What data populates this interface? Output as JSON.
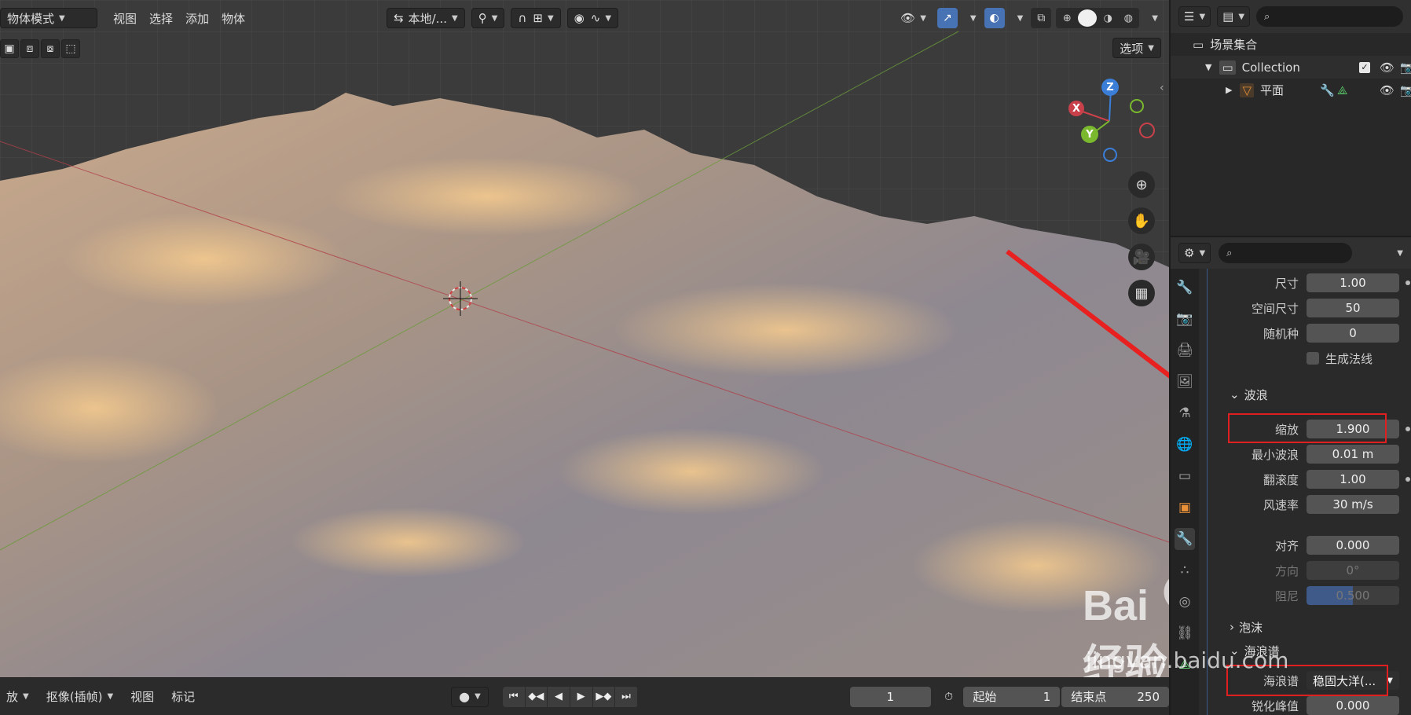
{
  "viewport": {
    "mode_label": "物体模式",
    "menus": [
      "视图",
      "选择",
      "添加",
      "物体"
    ],
    "transform_orientation": "本地/...",
    "options_label": "选项",
    "gizmo_axes": {
      "x": "X",
      "y": "Y",
      "z": "Z"
    }
  },
  "timeline": {
    "playback_label": "放",
    "keying_label": "抠像(插帧)",
    "view_label": "视图",
    "marker_label": "标记",
    "current_frame": "1",
    "start_label": "起始",
    "start_value": "1",
    "end_label": "结束点",
    "end_value": "250"
  },
  "outliner": {
    "scene_collection": "场景集合",
    "collection": "Collection",
    "object": "平面"
  },
  "properties": {
    "rows_top": [
      {
        "label": "尺寸",
        "value": "1.00"
      },
      {
        "label": "空间尺寸",
        "value": "50"
      },
      {
        "label": "随机种",
        "value": "0"
      }
    ],
    "normals_checkbox": "生成法线",
    "waves_section": "波浪",
    "waves_rows": [
      {
        "label": "缩放",
        "value": "1.900"
      },
      {
        "label": "最小波浪",
        "value": "0.01 m"
      },
      {
        "label": "翻滚度",
        "value": "1.00"
      },
      {
        "label": "风速率",
        "value": "30 m/s"
      }
    ],
    "align_rows": [
      {
        "label": "对齐",
        "value": "0.000"
      },
      {
        "label": "方向",
        "value": "0°"
      },
      {
        "label": "阻尼",
        "value": "0.500"
      }
    ],
    "foam_section": "泡沫",
    "spectrum_section": "海浪谱",
    "spectrum_label": "海浪谱",
    "spectrum_value": "稳固大洋(...",
    "sharpen_label": "锐化峰值",
    "sharpen_value": "0.000"
  },
  "watermark": {
    "logo": "Bai经验",
    "url": "jingyan.baidu.com"
  }
}
